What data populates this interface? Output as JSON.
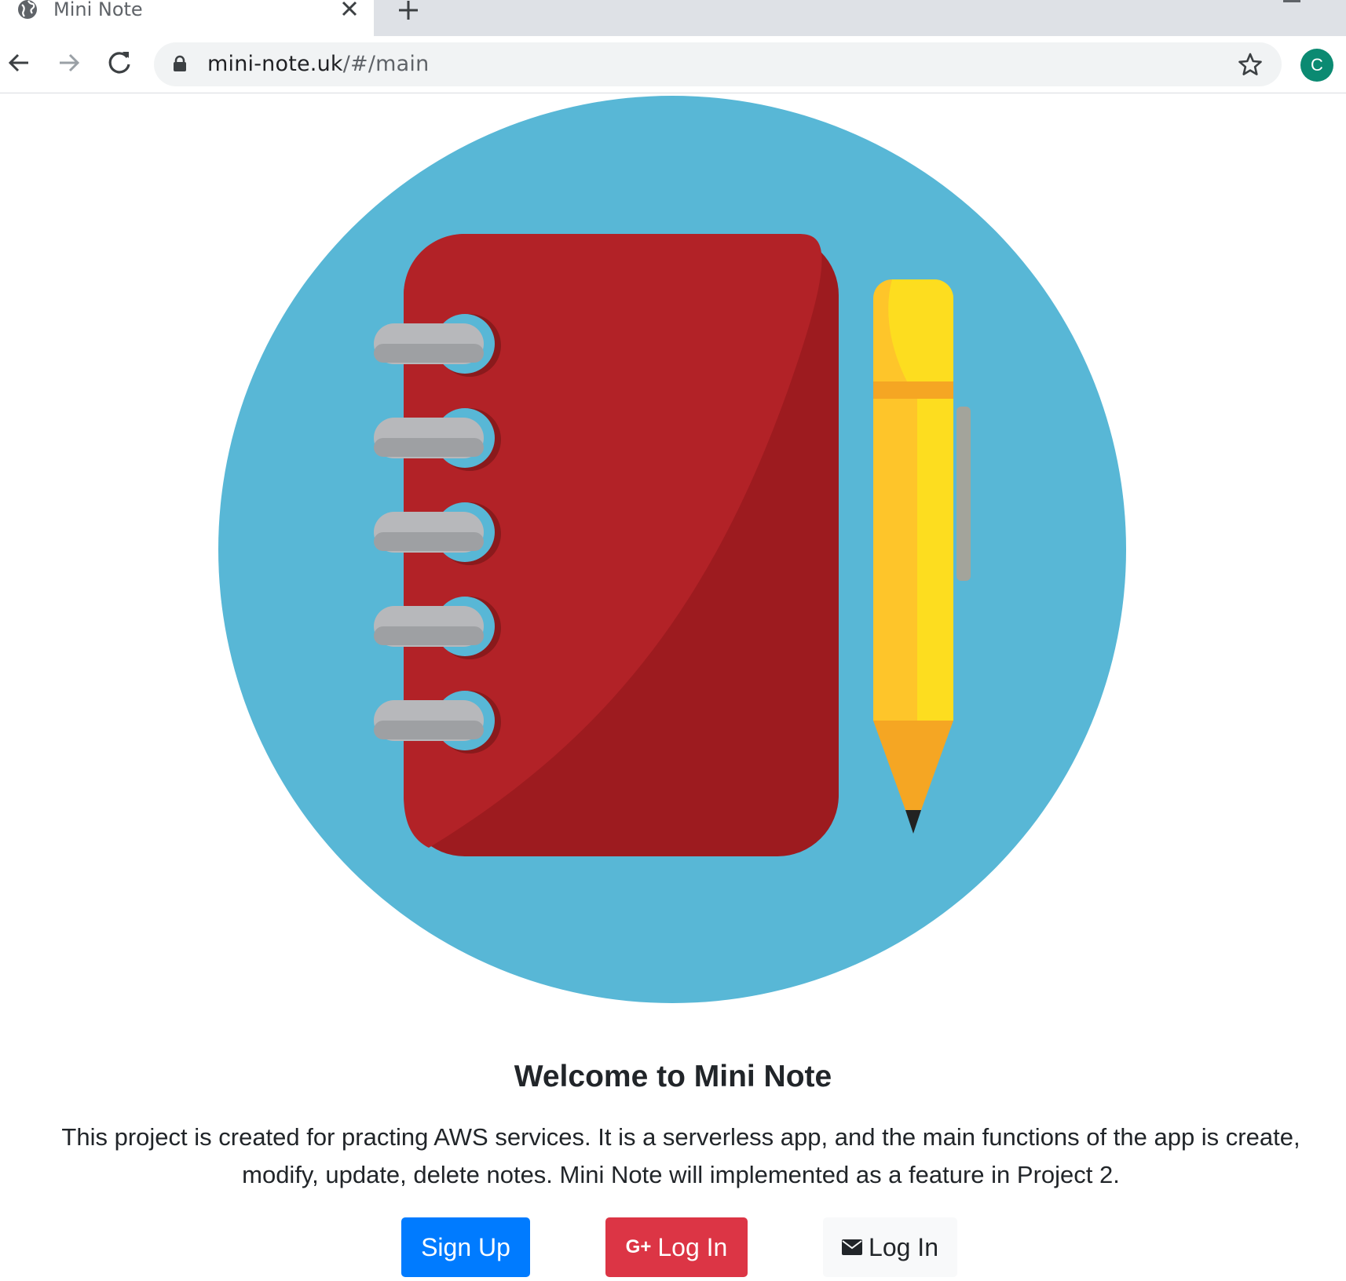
{
  "browser": {
    "tab_title": "Mini Note",
    "url_host": "mini-note.uk",
    "url_path": "/#/main",
    "profile_initial": "C",
    "profile_color": "#0b8a72"
  },
  "icons": {
    "favicon": "globe-icon",
    "tab_close": "close-icon",
    "new_tab": "plus-icon",
    "back": "arrow-left-icon",
    "forward": "arrow-right-icon",
    "reload": "reload-icon",
    "lock": "lock-icon",
    "bookmark": "star-icon",
    "google": "google-plus-icon",
    "email": "envelope-icon"
  },
  "main": {
    "heading": "Welcome to Mini Note",
    "description": "This project is created for practing AWS services. It is a serverless app, and the main functions of the app is create, modify, update, delete notes. Mini Note will implemented as a feature in Project 2.",
    "buttons": {
      "signup_label": "Sign Up",
      "google_login_label": "Log In",
      "google_icon_text": "G+",
      "email_login_label": "Log In"
    }
  },
  "colors": {
    "signup": "#007bff",
    "google": "#dc3545",
    "email": "#f8f9fa",
    "hero_circle": "#58b7d6",
    "notebook": "#b22227",
    "pencil": "#fdc324"
  }
}
